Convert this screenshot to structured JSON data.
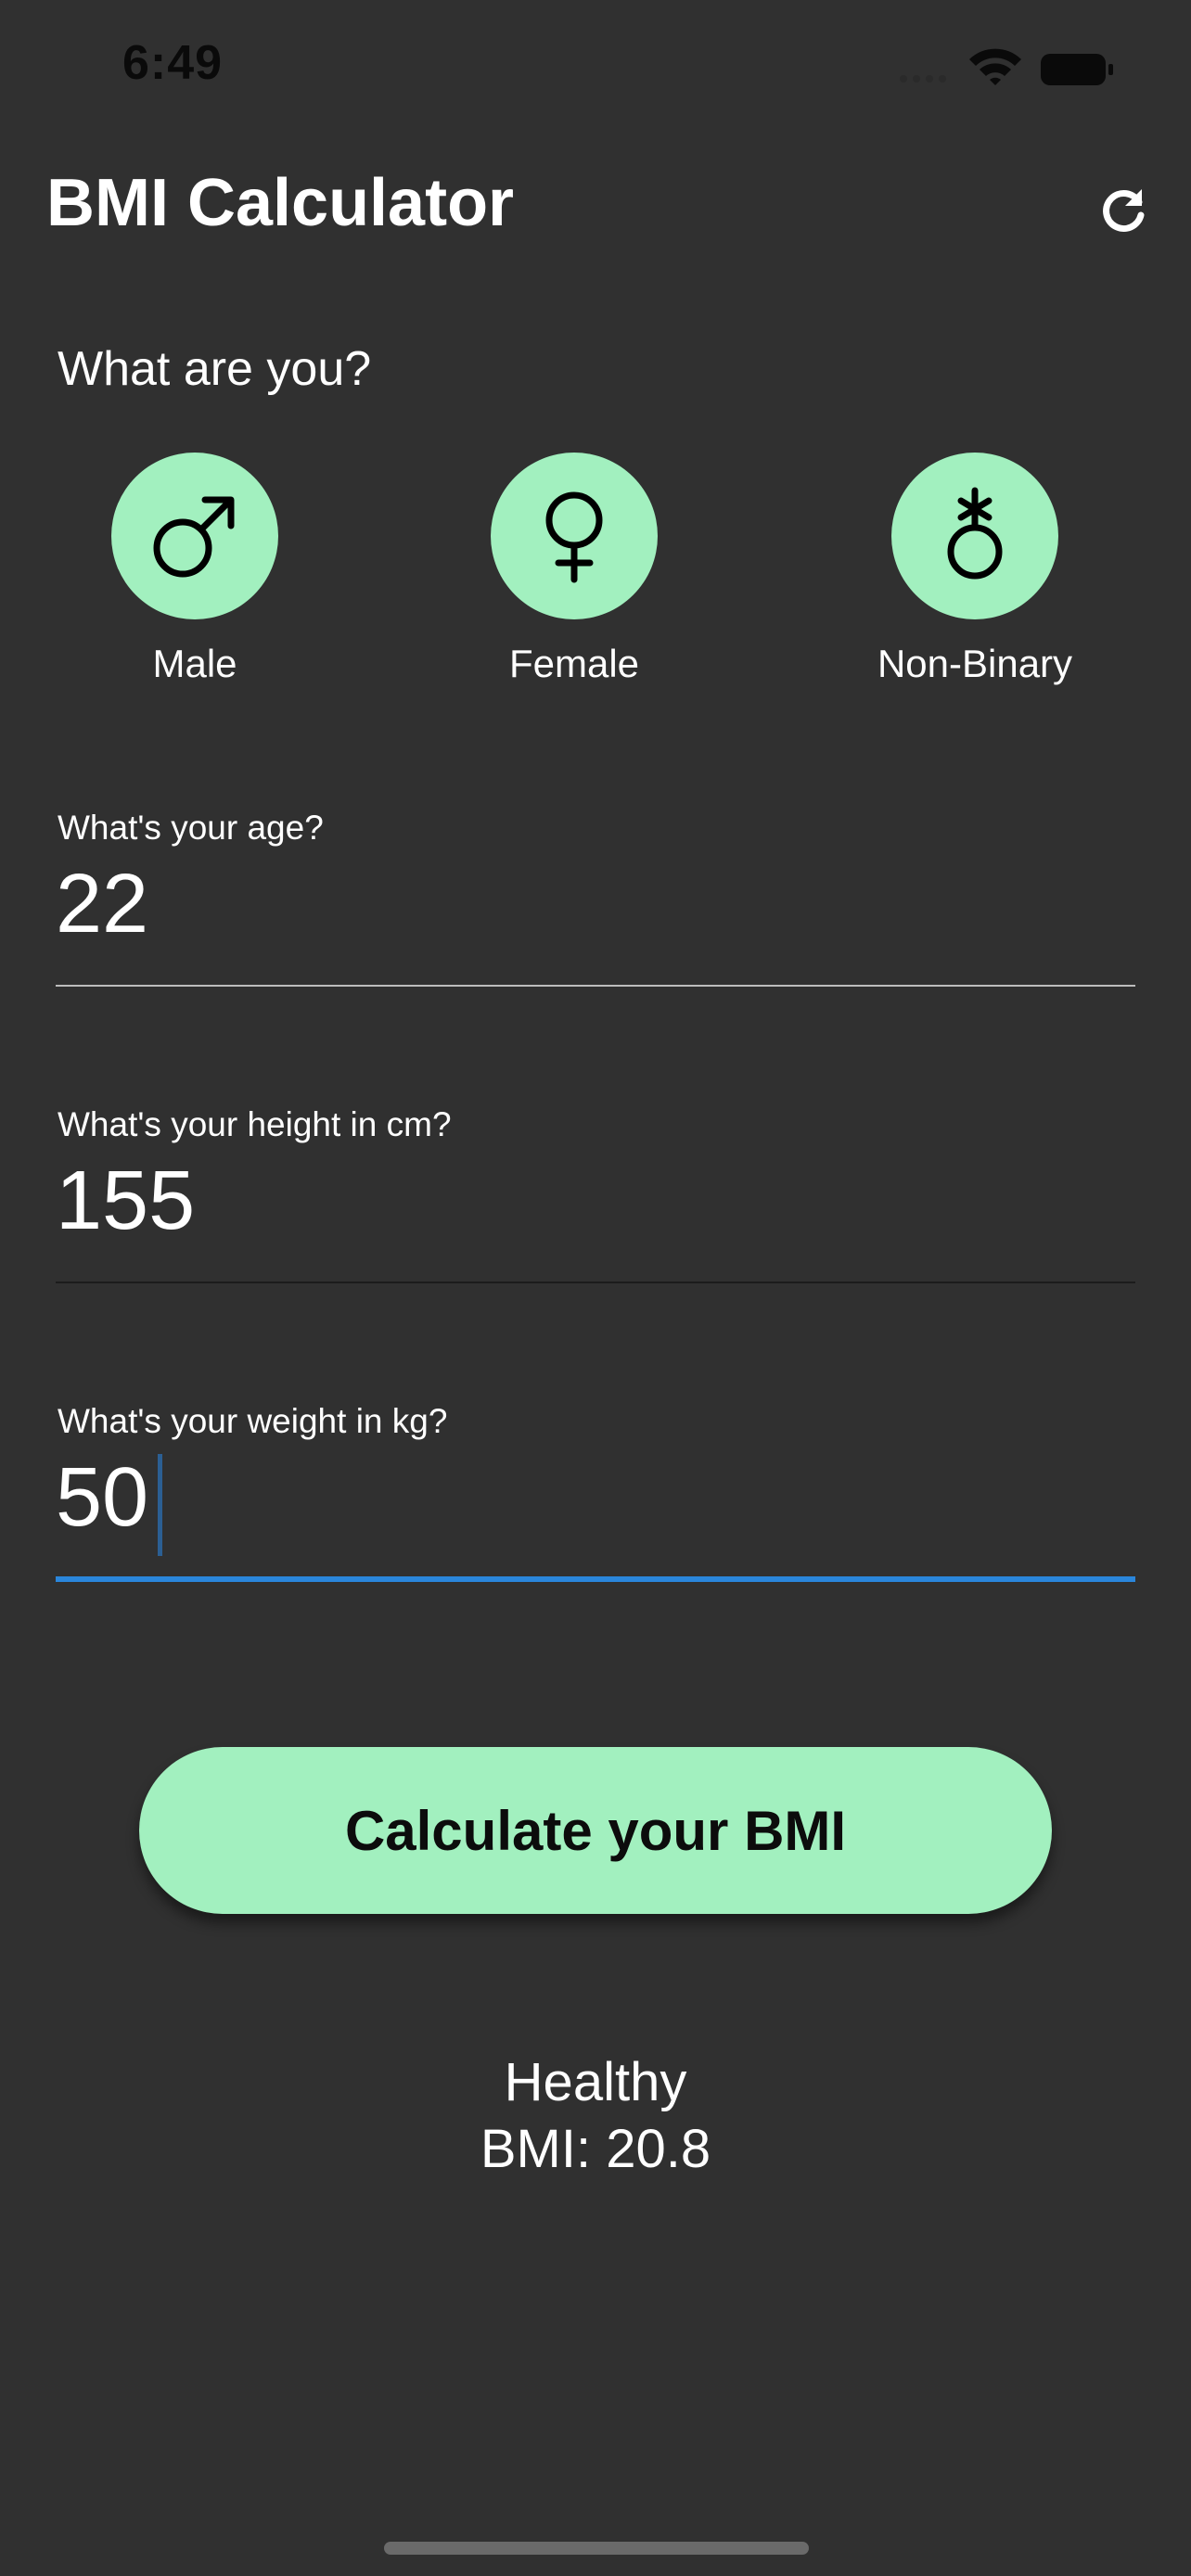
{
  "status_bar": {
    "time": "6:49",
    "icons": [
      "signal-icon",
      "wifi-icon",
      "battery-icon"
    ]
  },
  "app_bar": {
    "title": "BMI Calculator",
    "action_icon": "refresh-icon"
  },
  "gender": {
    "question": "What are you?",
    "options": [
      {
        "label": "Male",
        "icon": "male-icon"
      },
      {
        "label": "Female",
        "icon": "female-icon"
      },
      {
        "label": "Non-Binary",
        "icon": "non-binary-icon"
      }
    ]
  },
  "fields": {
    "age": {
      "label": "What's your age?",
      "value": "22"
    },
    "height": {
      "label": "What's your height in cm?",
      "value": "155"
    },
    "weight": {
      "label": "What's your weight in kg?",
      "value": "50"
    }
  },
  "calculate_button": {
    "label": "Calculate your BMI"
  },
  "result": {
    "category": "Healthy",
    "bmi_text": "BMI: 20.8"
  },
  "colors": {
    "background": "#303030",
    "accent": "#a2f0bf",
    "focus": "#2a86db"
  }
}
